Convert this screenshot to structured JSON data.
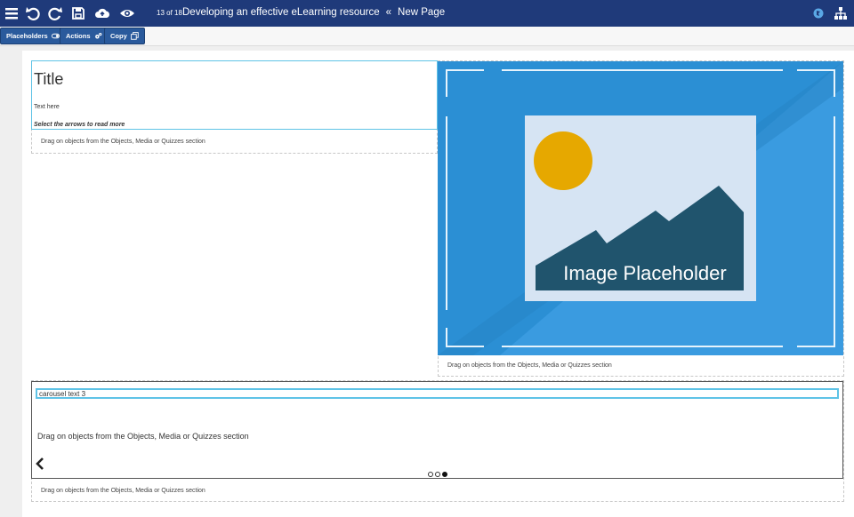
{
  "topbar": {
    "page_count": "13 of 18",
    "course_title": "Developing an effective eLearning resource",
    "separator": "«",
    "page_name": "New Page",
    "icons": [
      "menu-icon",
      "undo-icon",
      "redo-icon",
      "save-icon",
      "cloud-upload-icon",
      "eye-icon",
      "globe-icon",
      "sitemap-icon"
    ],
    "color": "#1f3a7a"
  },
  "toolbar": {
    "placeholders_label": "Placeholders",
    "actions_label": "Actions",
    "copy_label": "Copy",
    "button_color": "#2a5a9c"
  },
  "content": {
    "title": "Title",
    "text": "Text here",
    "instruction": "Select the arrows to read more",
    "drag_hint": "Drag on objects from the Objects, Media or Quizzes section",
    "image_label": "Image Placeholder",
    "image_color": "#2b8fd4"
  },
  "carousel": {
    "text": "carousel text 3",
    "drag_hint": "Drag on objects from the Objects, Media or Quizzes section",
    "dots": [
      "slide-1",
      "slide-2",
      "slide-3"
    ],
    "active_index": 3
  }
}
